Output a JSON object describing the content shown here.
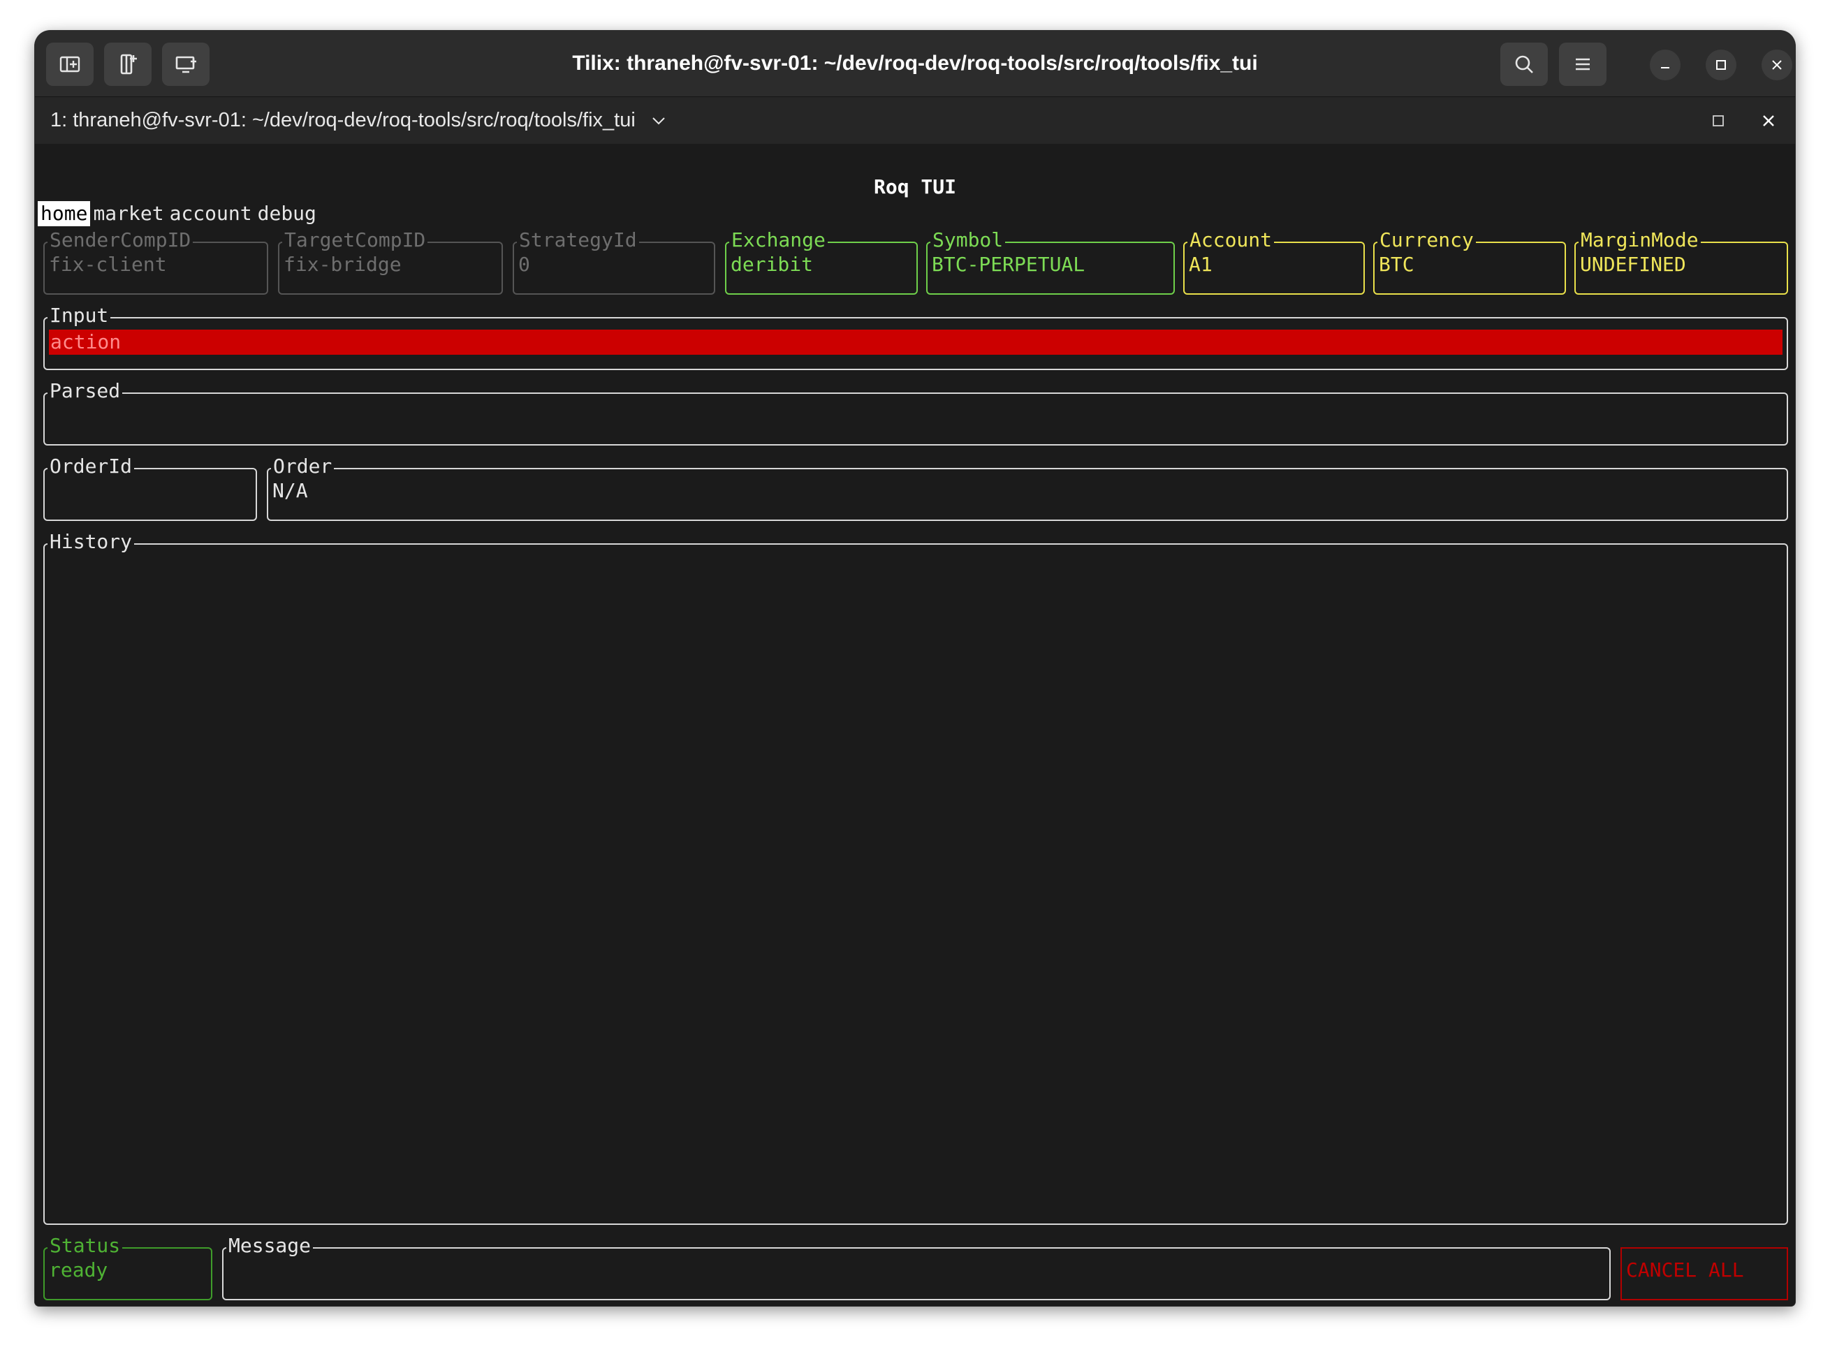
{
  "window": {
    "title": "Tilix: thraneh@fv-svr-01: ~/dev/roq-dev/roq-tools/src/roq/tools/fix_tui",
    "session_title": "1: thraneh@fv-svr-01: ~/dev/roq-dev/roq-tools/src/roq/tools/fix_tui",
    "left_buttons": [
      "add-terminal-right-icon",
      "add-terminal-down-icon",
      "new-session-icon"
    ],
    "right_buttons": [
      "search-icon",
      "menu-icon"
    ],
    "controls": [
      "minimize-icon",
      "maximize-icon",
      "close-icon"
    ]
  },
  "tui": {
    "title": "Roq TUI",
    "tabs": [
      {
        "label": "home",
        "active": true
      },
      {
        "label": "market",
        "active": false
      },
      {
        "label": "account",
        "active": false
      },
      {
        "label": "debug",
        "active": false
      }
    ],
    "fields": {
      "sender_comp_id": {
        "label": "SenderCompID",
        "value": "fix-client"
      },
      "target_comp_id": {
        "label": "TargetCompID",
        "value": "fix-bridge"
      },
      "strategy_id": {
        "label": "StrategyId",
        "value": "0"
      },
      "exchange": {
        "label": "Exchange",
        "value": "deribit"
      },
      "symbol": {
        "label": "Symbol",
        "value": "BTC-PERPETUAL"
      },
      "account": {
        "label": "Account",
        "value": "A1"
      },
      "currency": {
        "label": "Currency",
        "value": "BTC"
      },
      "margin_mode": {
        "label": "MarginMode",
        "value": "UNDEFINED"
      }
    },
    "input": {
      "label": "Input",
      "value": "action"
    },
    "parsed": {
      "label": "Parsed",
      "value": ""
    },
    "order_id": {
      "label": "OrderId",
      "value": ""
    },
    "order": {
      "label": "Order",
      "value": "N/A"
    },
    "history": {
      "label": "History"
    },
    "status": {
      "label": "Status",
      "value": "ready"
    },
    "message": {
      "label": "Message",
      "value": ""
    },
    "cancel_all": {
      "label": "CANCEL ALL"
    }
  },
  "colors": {
    "terminal_bg": "#1b1b1b",
    "input_highlight": "#cc0000",
    "green": "#7ddc55",
    "yellow": "#efe55a",
    "cancel_red": "#c00000"
  }
}
